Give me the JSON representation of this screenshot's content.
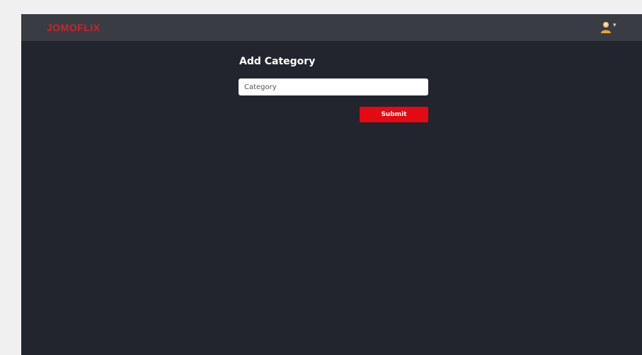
{
  "navbar": {
    "logo_text": "JOMOFLIX",
    "avatar_icon": "user-avatar-icon",
    "caret_glyph": "▾"
  },
  "form": {
    "title": "Add Category",
    "category_placeholder": "Category",
    "category_value": "",
    "submit_label": "Submit"
  },
  "colors": {
    "page_bg": "#f0f0f0",
    "app_bg": "#22252d",
    "navbar_bg": "#3a3c44",
    "brand_red": "#d81f26",
    "button_red": "#e50914",
    "input_bg": "#ffffff"
  }
}
